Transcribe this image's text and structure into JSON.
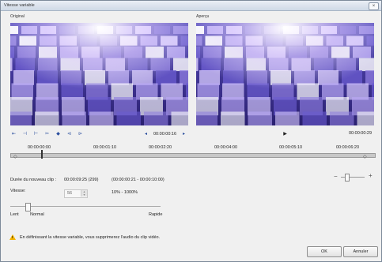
{
  "window": {
    "title": "Vitesse variable",
    "close_glyph": "×"
  },
  "panels": {
    "original_label": "Original",
    "preview_label": "Aperçu"
  },
  "transport": {
    "original_timecode": "00:00:00:16",
    "preview_timecode": "00:00:00:29",
    "icons": [
      "go-start-icon",
      "prev-frame-icon",
      "mark-in-icon",
      "mark-out-icon",
      "add-keyframe-icon",
      "prev-keyframe-icon",
      "next-keyframe-icon",
      "play-icon"
    ]
  },
  "timeline": {
    "ticks": [
      "00:00:00:00",
      "00:00:01:10",
      "00:00:02:20",
      "00:00:04:00",
      "00:00:05:10",
      "00:00:06:20"
    ]
  },
  "clip": {
    "duration_label": "Durée du nouveau clip :",
    "duration_value": "00:00:09:25 (299)",
    "range_value": "(00:00:00:21 - 00:00:10:00)",
    "speed_label": "Vitesse:",
    "speed_value": "56",
    "speed_range": "10% - 1000%"
  },
  "speed_slider": {
    "left_label": "Lent",
    "mid_label": "Normal",
    "right_label": "Rapide"
  },
  "zoom": {
    "minus": "−",
    "plus": "+"
  },
  "warning_text": "En définissant la vitesse variable, vous supprimerez l'audio du clip vidéo.",
  "buttons": {
    "ok": "OK",
    "cancel": "Annuler"
  },
  "colors": {
    "accent": "#2b4f9e",
    "warning": "#f2b300"
  }
}
